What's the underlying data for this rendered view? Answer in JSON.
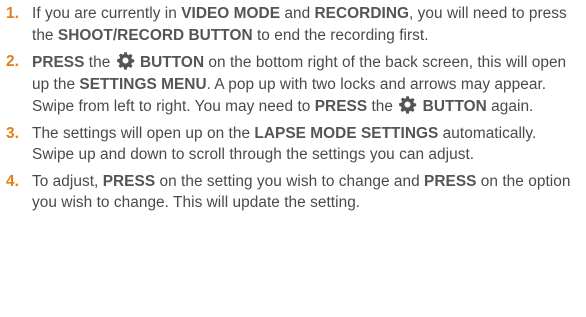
{
  "steps": [
    {
      "number": "1.",
      "segments": [
        {
          "t": "text",
          "v": "If you are currently in "
        },
        {
          "t": "bold",
          "v": "VIDEO MODE"
        },
        {
          "t": "text",
          "v": " and "
        },
        {
          "t": "bold",
          "v": "RECORDING"
        },
        {
          "t": "text",
          "v": ", you will need to press the "
        },
        {
          "t": "bold",
          "v": "SHOOT/RECORD BUTTON"
        },
        {
          "t": "text",
          "v": " to end the recording first."
        }
      ]
    },
    {
      "number": "2.",
      "segments": [
        {
          "t": "bold",
          "v": "PRESS"
        },
        {
          "t": "text",
          "v": " the "
        },
        {
          "t": "icon",
          "v": "gear-icon"
        },
        {
          "t": "bold",
          "v": " BUTTON"
        },
        {
          "t": "text",
          "v": " on the bottom right of the back screen, this will open up the "
        },
        {
          "t": "bold",
          "v": "SETTINGS MENU"
        },
        {
          "t": "text",
          "v": ". A pop up with two locks and arrows may appear. Swipe from left to right. You may need to "
        },
        {
          "t": "bold",
          "v": "PRESS"
        },
        {
          "t": "text",
          "v": " the "
        },
        {
          "t": "icon",
          "v": "gear-icon"
        },
        {
          "t": "bold",
          "v": " BUTTON"
        },
        {
          "t": "text",
          "v": " again."
        }
      ]
    },
    {
      "number": "3.",
      "segments": [
        {
          "t": "text",
          "v": "The settings will open up on the "
        },
        {
          "t": "bold",
          "v": "LAPSE MODE SETTINGS"
        },
        {
          "t": "text",
          "v": " automatically. Swipe up and down to scroll through the settings you can adjust."
        }
      ]
    },
    {
      "number": "4.",
      "segments": [
        {
          "t": "text",
          "v": "To adjust, "
        },
        {
          "t": "bold",
          "v": "PRESS"
        },
        {
          "t": "text",
          "v": " on the setting you wish to change and "
        },
        {
          "t": "bold",
          "v": "PRESS"
        },
        {
          "t": "text",
          "v": " on the option you wish to change. This will update the setting."
        }
      ]
    }
  ],
  "colors": {
    "number": "#e0801a",
    "body_text": "#4a4a4a",
    "bold_text": "#555555",
    "icon": "#555555"
  }
}
